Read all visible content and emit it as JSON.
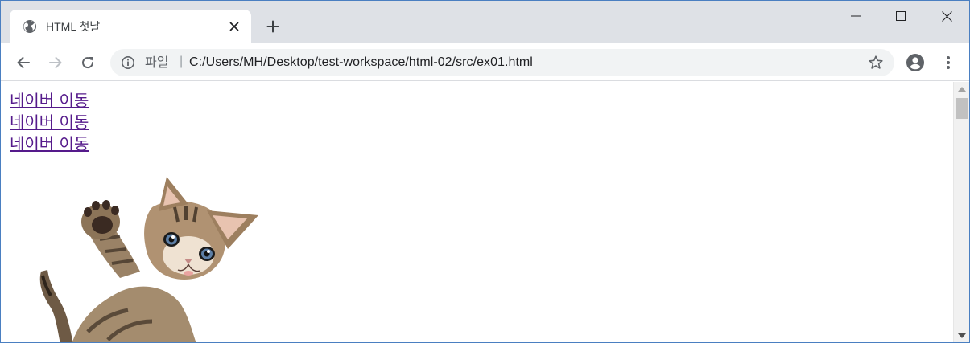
{
  "tab": {
    "title": "HTML 첫날",
    "favicon": "globe-icon"
  },
  "toolbar": {
    "scheme_label": "파일",
    "separator": "|",
    "url": "C:/Users/MH/Desktop/test-workspace/html-02/src/ex01.html"
  },
  "icons": {
    "back": "arrow-left-icon",
    "forward": "arrow-right-icon",
    "reload": "reload-icon",
    "info": "info-icon",
    "bookmark": "star-icon",
    "profile": "account-icon",
    "menu": "kebab-menu-icon",
    "new_tab": "plus-icon",
    "close_tab": "close-icon"
  },
  "page": {
    "links": [
      {
        "label": "네이버 이동"
      },
      {
        "label": "네이버 이동"
      },
      {
        "label": "네이버 이동"
      }
    ],
    "image": "kitten-image"
  },
  "colors": {
    "titlebar": "#dee1e6",
    "link_visited": "#551a8b",
    "omnibox": "#f1f3f4"
  }
}
